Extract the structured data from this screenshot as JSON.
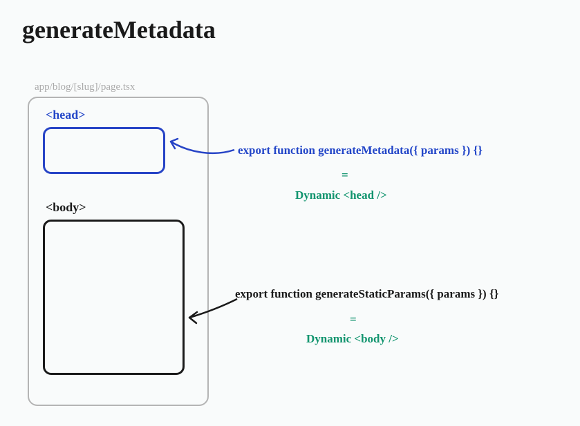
{
  "title": "generateMetadata",
  "file_path": "app/blog/[slug]/page.tsx",
  "head_label": "<head>",
  "body_label": "<body>",
  "meta_function": "export function generateMetadata({ params }) {}",
  "equals": "=",
  "dynamic_head": "Dynamic <head />",
  "static_function": "export function generateStaticParams({ params }) {}",
  "dynamic_body": "Dynamic <body />"
}
